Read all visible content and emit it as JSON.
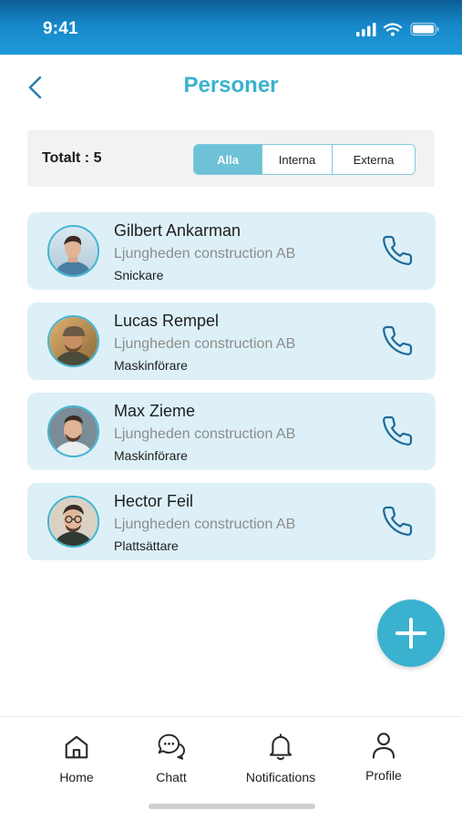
{
  "status_bar": {
    "time": "9:41"
  },
  "header": {
    "title": "Personer"
  },
  "filter": {
    "total_label": "Totalt : 5",
    "tabs": [
      {
        "label": "Alla",
        "active": true
      },
      {
        "label": "Interna",
        "active": false
      },
      {
        "label": "Externa",
        "active": false
      }
    ]
  },
  "contacts": [
    {
      "name": "Gilbert Ankarman",
      "company": "Ljungheden construction AB",
      "role": "Snickare"
    },
    {
      "name": "Lucas Rempel",
      "company": "Ljungheden construction AB",
      "role": "Maskinförare"
    },
    {
      "name": "Max Zieme",
      "company": "Ljungheden construction AB",
      "role": "Maskinförare"
    },
    {
      "name": "Hector Feil",
      "company": "Ljungheden construction AB",
      "role": "Plattsättare"
    }
  ],
  "bottom_nav": {
    "items": [
      {
        "label": "Home",
        "icon": "home-icon"
      },
      {
        "label": "Chatt",
        "icon": "chat-icon"
      },
      {
        "label": "Notifications",
        "icon": "bell-icon"
      },
      {
        "label": "Profile",
        "icon": "user-icon"
      }
    ]
  },
  "colors": {
    "accent": "#3ab2cf",
    "card_bg": "#ddf0f7",
    "status_bar": "#1787c9",
    "call_icon": "#1f6c9c"
  }
}
